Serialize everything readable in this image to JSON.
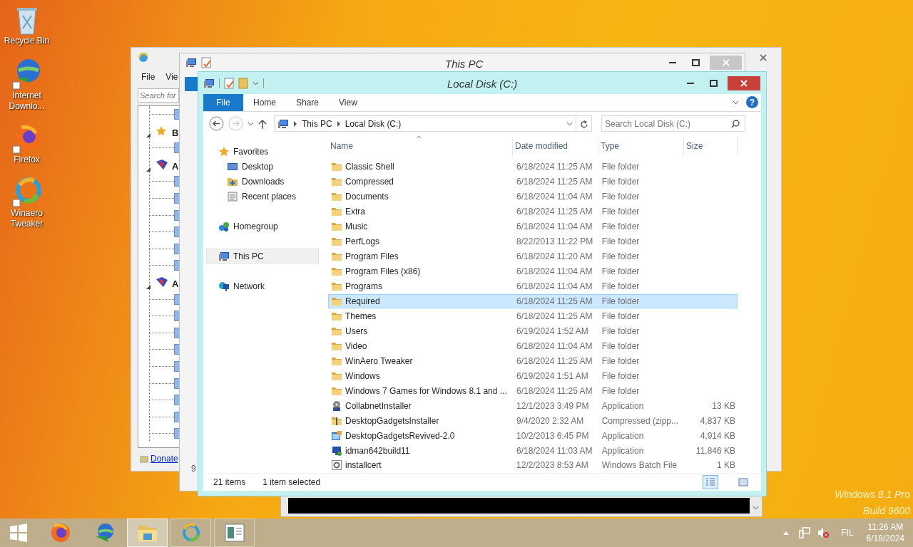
{
  "desktop_icons": [
    {
      "label": "Recycle Bin",
      "kind": "recycle"
    },
    {
      "label": "Internet Downlo...",
      "kind": "idm"
    },
    {
      "label": "Firefox",
      "kind": "firefox"
    },
    {
      "label": "Winaero Tweaker",
      "kind": "winaero"
    }
  ],
  "back_window": {
    "menu": [
      "File",
      "Vie"
    ],
    "search": {
      "placeholder": "Search for"
    },
    "tree": [
      {
        "label": "B",
        "expanded": true
      },
      {
        "label": "A",
        "expanded": true
      },
      {
        "label": "A",
        "expanded": true
      }
    ],
    "donate_link": "Donate"
  },
  "behind_window": {
    "title": "This PC",
    "fragment": "9"
  },
  "explorer": {
    "title": "Local Disk (C:)",
    "ribbon": {
      "file_tab": "File",
      "tabs": [
        "Home",
        "Share",
        "View"
      ],
      "help": "?"
    },
    "breadcrumb": [
      "This PC",
      "Local Disk (C:)"
    ],
    "search": {
      "placeholder": "Search Local Disk (C:)"
    },
    "nav": [
      {
        "label": "Favorites",
        "kind": "star",
        "selected": false,
        "children": [
          {
            "label": "Desktop",
            "kind": "desktop",
            "selected": false
          },
          {
            "label": "Downloads",
            "kind": "downloads",
            "selected": false
          },
          {
            "label": "Recent places",
            "kind": "recent",
            "selected": false
          }
        ]
      },
      {
        "label": "Homegroup",
        "kind": "homegroup",
        "selected": false
      },
      {
        "label": "This PC",
        "kind": "pc",
        "selected": true
      },
      {
        "label": "Network",
        "kind": "network",
        "selected": false
      }
    ],
    "columns": [
      "Name",
      "Date modified",
      "Type",
      "Size"
    ],
    "rows": [
      {
        "name": "Classic Shell",
        "date": "6/18/2024 11:25 AM",
        "type": "File folder",
        "kind": "folder",
        "selected": false
      },
      {
        "name": "Compressed",
        "date": "6/18/2024 11:25 AM",
        "type": "File folder",
        "kind": "folder",
        "selected": false
      },
      {
        "name": "Documents",
        "date": "6/18/2024 11:04 AM",
        "type": "File folder",
        "kind": "folder",
        "selected": false
      },
      {
        "name": "Extra",
        "date": "6/18/2024 11:25 AM",
        "type": "File folder",
        "kind": "folder",
        "selected": false
      },
      {
        "name": "Music",
        "date": "6/18/2024 11:04 AM",
        "type": "File folder",
        "kind": "folder",
        "selected": false
      },
      {
        "name": "PerfLogs",
        "date": "8/22/2013 11:22 PM",
        "type": "File folder",
        "kind": "folder",
        "selected": false
      },
      {
        "name": "Program Files",
        "date": "6/18/2024 11:20 AM",
        "type": "File folder",
        "kind": "folder",
        "selected": false
      },
      {
        "name": "Program Files (x86)",
        "date": "6/18/2024 11:04 AM",
        "type": "File folder",
        "kind": "folder",
        "selected": false
      },
      {
        "name": "Programs",
        "date": "6/18/2024 11:04 AM",
        "type": "File folder",
        "kind": "folder",
        "selected": false
      },
      {
        "name": "Required",
        "date": "6/18/2024 11:25 AM",
        "type": "File folder",
        "kind": "folder",
        "selected": true
      },
      {
        "name": "Themes",
        "date": "6/18/2024 11:25 AM",
        "type": "File folder",
        "kind": "folder",
        "selected": false
      },
      {
        "name": "Users",
        "date": "6/19/2024 1:52 AM",
        "type": "File folder",
        "kind": "folder",
        "selected": false
      },
      {
        "name": "Video",
        "date": "6/18/2024 11:04 AM",
        "type": "File folder",
        "kind": "folder",
        "selected": false
      },
      {
        "name": "WinAero Tweaker",
        "date": "6/18/2024 11:25 AM",
        "type": "File folder",
        "kind": "folder",
        "selected": false
      },
      {
        "name": "Windows",
        "date": "6/19/2024 1:51 AM",
        "type": "File folder",
        "kind": "folder",
        "selected": false
      },
      {
        "name": "Windows 7 Games for Windows 8.1 and ...",
        "date": "6/18/2024 11:25 AM",
        "type": "File folder",
        "kind": "folder",
        "selected": false
      },
      {
        "name": "CollabnetInstaller",
        "date": "12/1/2023 3:49 PM",
        "type": "Application",
        "size": "13 KB",
        "kind": "installer",
        "selected": false
      },
      {
        "name": "DesktopGadgetsInstaller",
        "date": "9/4/2020 2:32 AM",
        "type": "Compressed (zipp...",
        "size": "4,837 KB",
        "kind": "zip",
        "selected": false
      },
      {
        "name": "DesktopGadgetsRevived-2.0",
        "date": "10/2/2013 6:45 PM",
        "type": "Application",
        "size": "4,914 KB",
        "kind": "app",
        "selected": false
      },
      {
        "name": "idman642build11",
        "date": "6/18/2024 11:03 AM",
        "type": "Application",
        "size": "11,846 KB",
        "kind": "idm",
        "selected": false
      },
      {
        "name": "installcert",
        "date": "12/2/2023 8:53 AM",
        "type": "Windows Batch File",
        "size": "1 KB",
        "kind": "batch",
        "selected": false
      }
    ],
    "status": {
      "count": "21 items",
      "selection": "1 item selected"
    },
    "views": [
      {
        "kind": "details",
        "selected": true
      },
      {
        "kind": "large",
        "selected": false
      }
    ]
  },
  "watermark": [
    "Windows 8.1 Pro",
    "Build 9600"
  ],
  "taskbar": {
    "items": [
      {
        "kind": "firefox",
        "active": false
      },
      {
        "kind": "idm",
        "active": false
      },
      {
        "kind": "explorer",
        "active": true
      },
      {
        "kind": "winaero",
        "active": false
      },
      {
        "kind": "console",
        "active": false
      }
    ],
    "language": "FIL",
    "time": "11:26 AM",
    "date": "6/18/2024"
  }
}
